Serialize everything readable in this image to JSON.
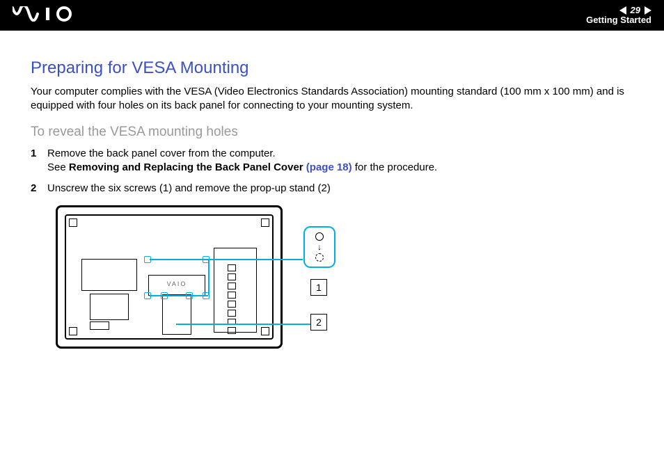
{
  "header": {
    "page_number": "29",
    "section": "Getting Started",
    "brand": "VAIO"
  },
  "content": {
    "heading": "Preparing for VESA Mounting",
    "intro": "Your computer complies with the VESA (Video Electronics Standards Association) mounting standard (100 mm x 100 mm) and is equipped with four holes on its back panel for connecting to your mounting system.",
    "subheading": "To reveal the VESA mounting holes",
    "steps": [
      {
        "num": "1",
        "text_a": "Remove the back panel cover from the computer.",
        "text_b_prefix": "See ",
        "text_b_bold": "Removing and Replacing the Back Panel Cover ",
        "text_b_link": "(page 18)",
        "text_b_suffix": " for the procedure."
      },
      {
        "num": "2",
        "text_a": "Unscrew the six screws (1) and remove the prop-up stand (2)"
      }
    ],
    "diagram": {
      "stand_brand": "VAIO",
      "label_1": "1",
      "label_2": "2"
    }
  }
}
